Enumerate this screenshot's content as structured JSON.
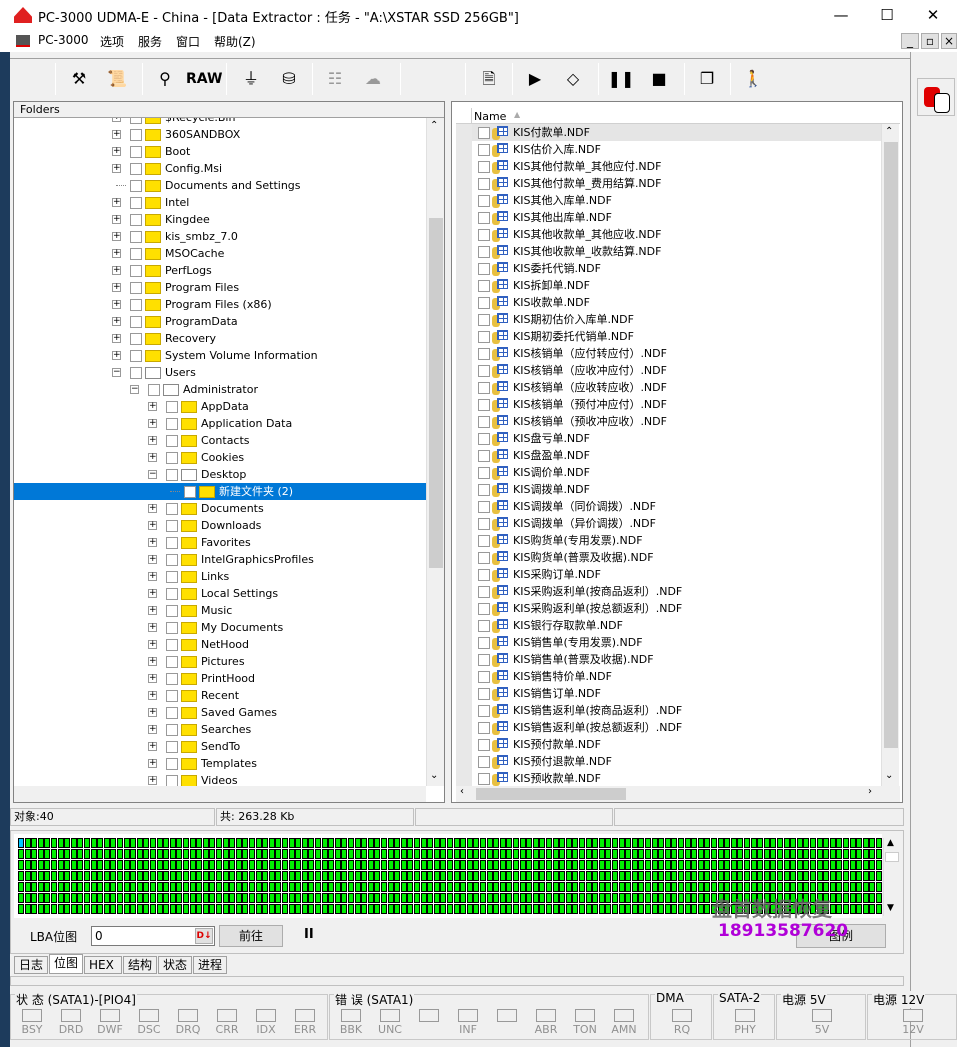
{
  "window": {
    "title": "PC-3000 UDMA-E - China - [Data Extractor : 任务 - \"A:\\XSTAR SSD 256GB\"]",
    "minimize": "—",
    "maximize": "☐",
    "close": "✕"
  },
  "menu": [
    "PC-3000",
    "选项",
    "服务",
    "窗口",
    "帮助(Z)"
  ],
  "toolbar": {
    "raw_label": "RAW",
    "icons": [
      "tools-icon",
      "info-scroll-icon",
      "binoculars-icon",
      "raw-icon",
      "merge-icon",
      "disk-export-icon",
      "tree-icon-disabled",
      "tree-cloud-icon-disabled",
      "export-document-icon",
      "play-icon",
      "decision-icon",
      "pause-icon",
      "stop-icon",
      "windows-icon",
      "exit-icon"
    ]
  },
  "folders": {
    "header": "Folders",
    "items": [
      {
        "label": "$Recycle.Bin",
        "level": 0,
        "partial": true
      },
      {
        "label": "360SANDBOX",
        "level": 0
      },
      {
        "label": "Boot",
        "level": 0
      },
      {
        "label": "Config.Msi",
        "level": 0
      },
      {
        "label": "Documents and Settings",
        "level": 0,
        "noexp": true
      },
      {
        "label": "Intel",
        "level": 0
      },
      {
        "label": "Kingdee",
        "level": 0
      },
      {
        "label": "kis_smbz_7.0",
        "level": 0
      },
      {
        "label": "MSOCache",
        "level": 0
      },
      {
        "label": "PerfLogs",
        "level": 0
      },
      {
        "label": "Program Files",
        "level": 0
      },
      {
        "label": "Program Files (x86)",
        "level": 0
      },
      {
        "label": "ProgramData",
        "level": 0
      },
      {
        "label": "Recovery",
        "level": 0
      },
      {
        "label": "System Volume Information",
        "level": 0
      },
      {
        "label": "Users",
        "level": 0,
        "expanded": true
      },
      {
        "label": "Administrator",
        "level": 1,
        "expanded": true
      },
      {
        "label": "AppData",
        "level": 2
      },
      {
        "label": "Application Data",
        "level": 2
      },
      {
        "label": "Contacts",
        "level": 2
      },
      {
        "label": "Cookies",
        "level": 2
      },
      {
        "label": "Desktop",
        "level": 2,
        "expanded": true
      },
      {
        "label": "新建文件夹 (2)",
        "level": 3,
        "selected": true,
        "noexp": true
      },
      {
        "label": "Documents",
        "level": 2
      },
      {
        "label": "Downloads",
        "level": 2
      },
      {
        "label": "Favorites",
        "level": 2
      },
      {
        "label": "IntelGraphicsProfiles",
        "level": 2
      },
      {
        "label": "Links",
        "level": 2
      },
      {
        "label": "Local Settings",
        "level": 2
      },
      {
        "label": "Music",
        "level": 2
      },
      {
        "label": "My Documents",
        "level": 2
      },
      {
        "label": "NetHood",
        "level": 2
      },
      {
        "label": "Pictures",
        "level": 2
      },
      {
        "label": "PrintHood",
        "level": 2
      },
      {
        "label": "Recent",
        "level": 2
      },
      {
        "label": "Saved Games",
        "level": 2
      },
      {
        "label": "Searches",
        "level": 2
      },
      {
        "label": "SendTo",
        "level": 2
      },
      {
        "label": "Templates",
        "level": 2
      },
      {
        "label": "Videos",
        "level": 2
      }
    ]
  },
  "files": {
    "header": "Name",
    "sort": "▲",
    "items": [
      "KIS付款单.NDF",
      "KIS估价入库.NDF",
      "KIS其他付款单_其他应付.NDF",
      "KIS其他付款单_费用结算.NDF",
      "KIS其他入库单.NDF",
      "KIS其他出库单.NDF",
      "KIS其他收款单_其他应收.NDF",
      "KIS其他收款单_收款结算.NDF",
      "KIS委托代销.NDF",
      "KIS拆卸单.NDF",
      "KIS收款单.NDF",
      "KIS期初估价入库单.NDF",
      "KIS期初委托代销单.NDF",
      "KIS核销单（应付转应付）.NDF",
      "KIS核销单（应收冲应付）.NDF",
      "KIS核销单（应收转应收）.NDF",
      "KIS核销单（预付冲应付）.NDF",
      "KIS核销单（预收冲应收）.NDF",
      "KIS盘亏单.NDF",
      "KIS盘盈单.NDF",
      "KIS调价单.NDF",
      "KIS调拨单.NDF",
      "KIS调拨单（同价调拨）.NDF",
      "KIS调拨单（异价调拨）.NDF",
      "KIS购货单(专用发票).NDF",
      "KIS购货单(普票及收据).NDF",
      "KIS采购订单.NDF",
      "KIS采购返利单(按商品返利）.NDF",
      "KIS采购返利单(按总额返利）.NDF",
      "KIS银行存取款单.NDF",
      "KIS销售单(专用发票).NDF",
      "KIS销售单(普票及收据).NDF",
      "KIS销售特价单.NDF",
      "KIS销售订单.NDF",
      "KIS销售返利单(按商品返利）.NDF",
      "KIS销售返利单(按总额返利）.NDF",
      "KIS预付款单.NDF",
      "KIS预付退款单.NDF",
      "KIS预收款单.NDF"
    ]
  },
  "statusbar": {
    "objects": "对象:40",
    "total": "共: 263.28 Kb"
  },
  "bitmap": {
    "label": "LBA位图",
    "lba_value": "0",
    "goto": "前往",
    "pause": "II",
    "legend": "图例",
    "colors": {
      "ok": "#00ee00",
      "current": "#00c8ff"
    }
  },
  "tabs": [
    "日志",
    "位图",
    "HEX",
    "结构",
    "状态",
    "进程"
  ],
  "active_tab": "位图",
  "indicators": {
    "status": {
      "label": "状 态 (SATA1)-[PIO4]",
      "leds": [
        "BSY",
        "DRD",
        "DWF",
        "DSC",
        "DRQ",
        "CRR",
        "IDX",
        "ERR"
      ]
    },
    "error": {
      "label": "错 误 (SATA1)",
      "leds": [
        "BBK",
        "UNC",
        "",
        "INF",
        "",
        "ABR",
        "TON",
        "AMN"
      ]
    },
    "dma": {
      "label": "DMA",
      "leds": [
        "RQ"
      ]
    },
    "sata": {
      "label": "SATA-2",
      "leds": [
        "PHY"
      ]
    },
    "p5": {
      "label": "电源 5V",
      "leds": [
        "5V"
      ]
    },
    "p12": {
      "label": "电源 12V",
      "leds": [
        "12V"
      ]
    }
  },
  "watermark": {
    "name": "盘首数据恢复",
    "phone": "18913587620"
  }
}
